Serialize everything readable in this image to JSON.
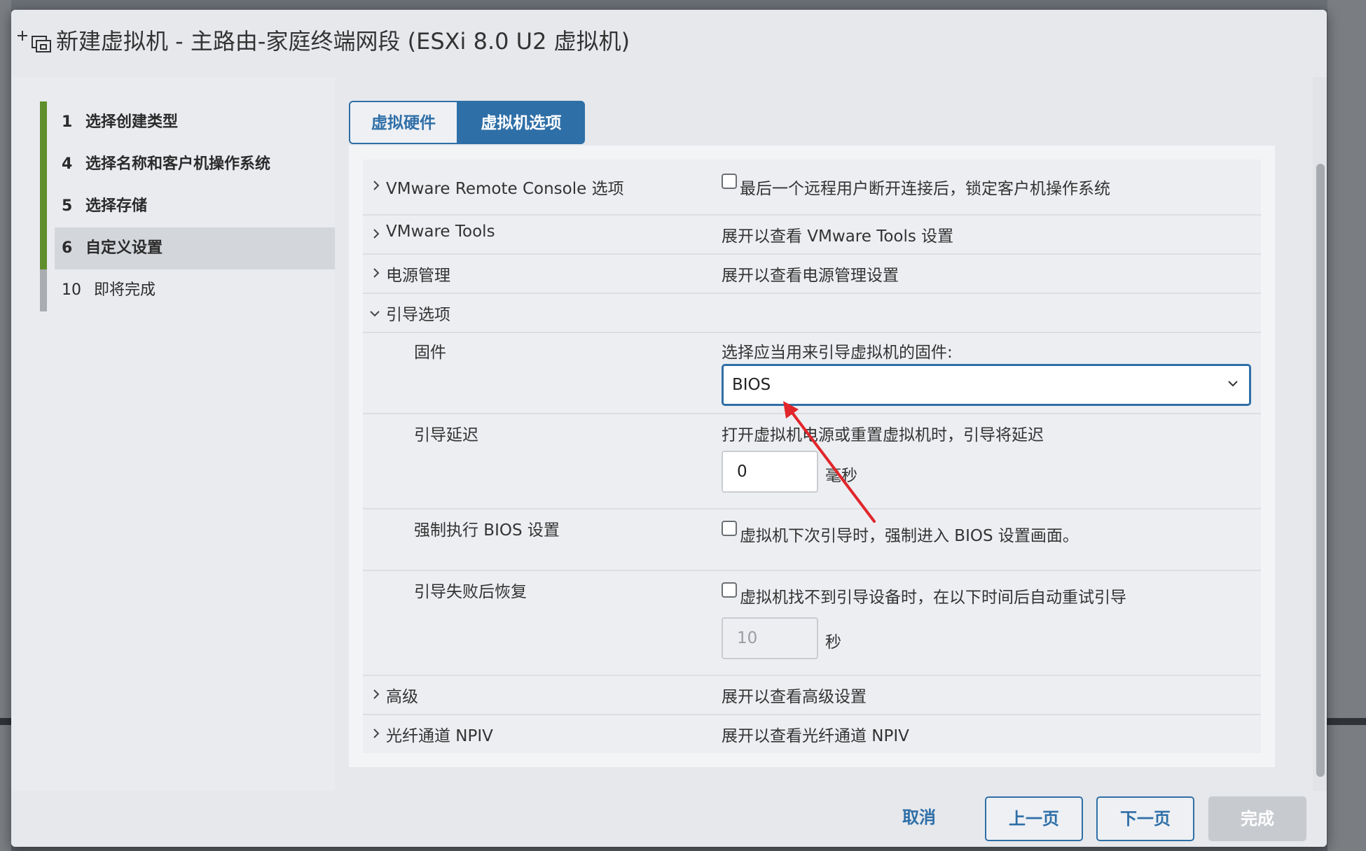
{
  "dialog": {
    "title": "新建虚拟机 - 主路由-家庭终端网段 (ESXi 8.0 U2 虚拟机)",
    "icon": "new-vm-icon"
  },
  "nav": {
    "items": [
      {
        "num": "1",
        "label": "选择创建类型",
        "bold": true,
        "active": false
      },
      {
        "num": "4",
        "label": "选择名称和客户机操作系统",
        "bold": true,
        "active": false
      },
      {
        "num": "5",
        "label": "选择存储",
        "bold": true,
        "active": false
      },
      {
        "num": "6",
        "label": "自定义设置",
        "bold": true,
        "active": true
      },
      {
        "num": "10",
        "label": "即将完成",
        "bold": false,
        "active": false
      }
    ]
  },
  "tabs": {
    "hardware": "虚拟硬件",
    "options": "虚拟机选项"
  },
  "options": {
    "vmrc": {
      "label": "VMware Remote Console 选项",
      "checkbox_label": "最后一个远程用户断开连接后，锁定客户机操作系统"
    },
    "tools": {
      "label": "VMware Tools",
      "value": "展开以查看 VMware Tools 设置"
    },
    "power": {
      "label": "电源管理",
      "value": "展开以查看电源管理设置"
    },
    "boot": {
      "label": "引导选项",
      "firmware": {
        "label": "固件",
        "prompt": "选择应当用来引导虚拟机的固件:",
        "selected": "BIOS"
      },
      "delay": {
        "label": "引导延迟",
        "prompt": "打开虚拟机电源或重置虚拟机时，引导将延迟",
        "value": "0",
        "unit": "毫秒"
      },
      "force_bios": {
        "label": "强制执行 BIOS 设置",
        "checkbox_label": "虚拟机下次引导时，强制进入 BIOS 设置画面。"
      },
      "recovery": {
        "label": "引导失败后恢复",
        "checkbox_label": "虚拟机找不到引导设备时，在以下时间后自动重试引导",
        "value": "10",
        "unit": "秒"
      }
    },
    "advanced": {
      "label": "高级",
      "value": "展开以查看高级设置"
    },
    "npiv": {
      "label": "光纤通道 NPIV",
      "value": "展开以查看光纤通道 NPIV"
    }
  },
  "footer": {
    "cancel": "取消",
    "back": "上一页",
    "next": "下一页",
    "finish": "完成"
  },
  "colors": {
    "accent": "#2f6fa7",
    "nav_complete": "#5f8f2a",
    "annotation_arrow": "#e0262b"
  }
}
